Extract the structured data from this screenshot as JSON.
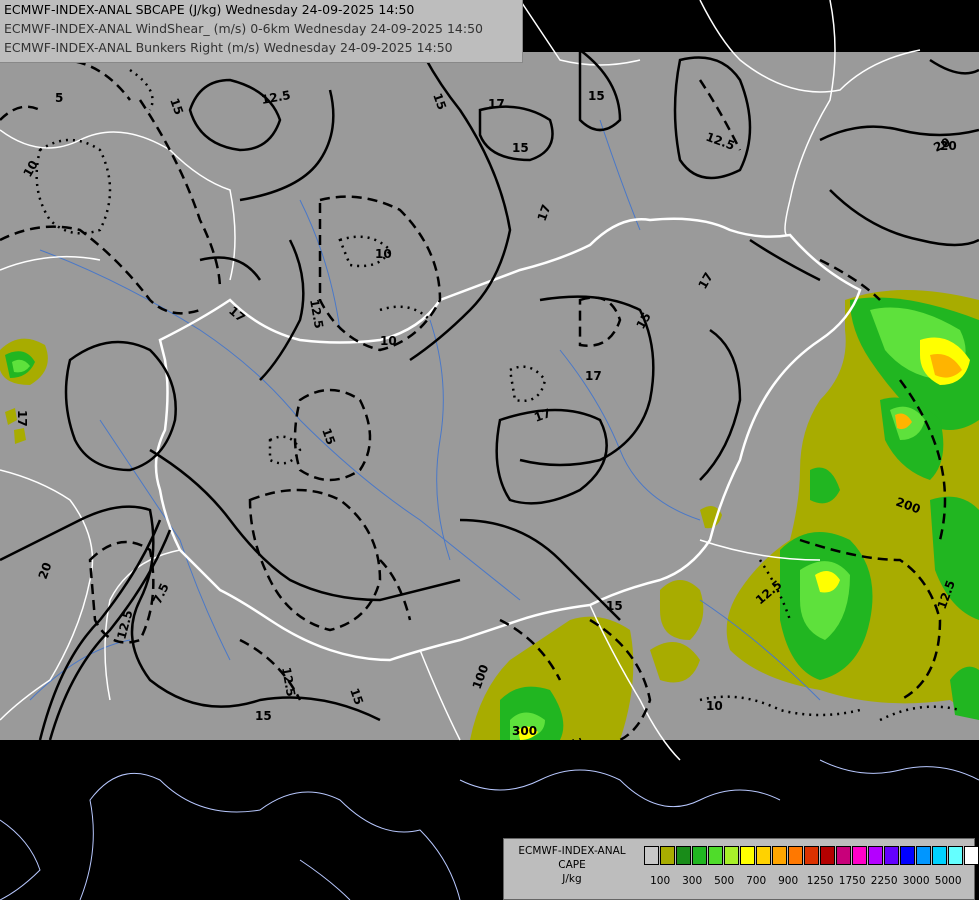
{
  "titles": [
    "ECMWF-INDEX-ANAL SBCAPE (J/kg) Wednesday 24-09-2025 14:50",
    "ECMWF-INDEX-ANAL WindShear_ (m/s) 0-6km Wednesday 24-09-2025 14:50",
    "ECMWF-INDEX-ANAL Bunkers Right (m/s) Wednesday 24-09-2025 14:50"
  ],
  "map": {
    "background": "#9a9a9a",
    "outside": "#000000",
    "contour_labels": [
      "12.5",
      "15",
      "17",
      "20",
      "10",
      "5",
      "7.5",
      "15",
      "17",
      "12.5",
      "15",
      "10",
      "17",
      "20",
      "17",
      "15",
      "12.5",
      "15",
      "17",
      "15",
      "17",
      "10",
      "12.5",
      "15",
      "20",
      "17",
      "12.5",
      "15",
      "12.5",
      "15",
      "10",
      "100",
      "200",
      "300",
      "10",
      "12.5"
    ],
    "cape_colors": {
      "olive": "#a8ac00",
      "green1": "#2fa02f",
      "green2": "#21c42a",
      "green3": "#5ee13c",
      "yellow": "#ffff00",
      "orange": "#ffb400"
    }
  },
  "legend": {
    "title_lines": [
      "ECMWF-INDEX-ANAL",
      "CAPE",
      "J/kg"
    ],
    "swatches": [
      "#c8c8c8",
      "#a8ac00",
      "#198c19",
      "#21b621",
      "#4fdc2a",
      "#a8f02a",
      "#ffff00",
      "#ffd200",
      "#ffa500",
      "#ff7800",
      "#dc3200",
      "#b40000",
      "#c8007a",
      "#ff00c8",
      "#b400ff",
      "#6400ff",
      "#0000ff",
      "#0096ff",
      "#00d2ff",
      "#64ffff",
      "#ffffff"
    ],
    "ticks": [
      "100",
      "300",
      "500",
      "700",
      "900",
      "1250",
      "1750",
      "2250",
      "3000",
      "5000"
    ]
  }
}
